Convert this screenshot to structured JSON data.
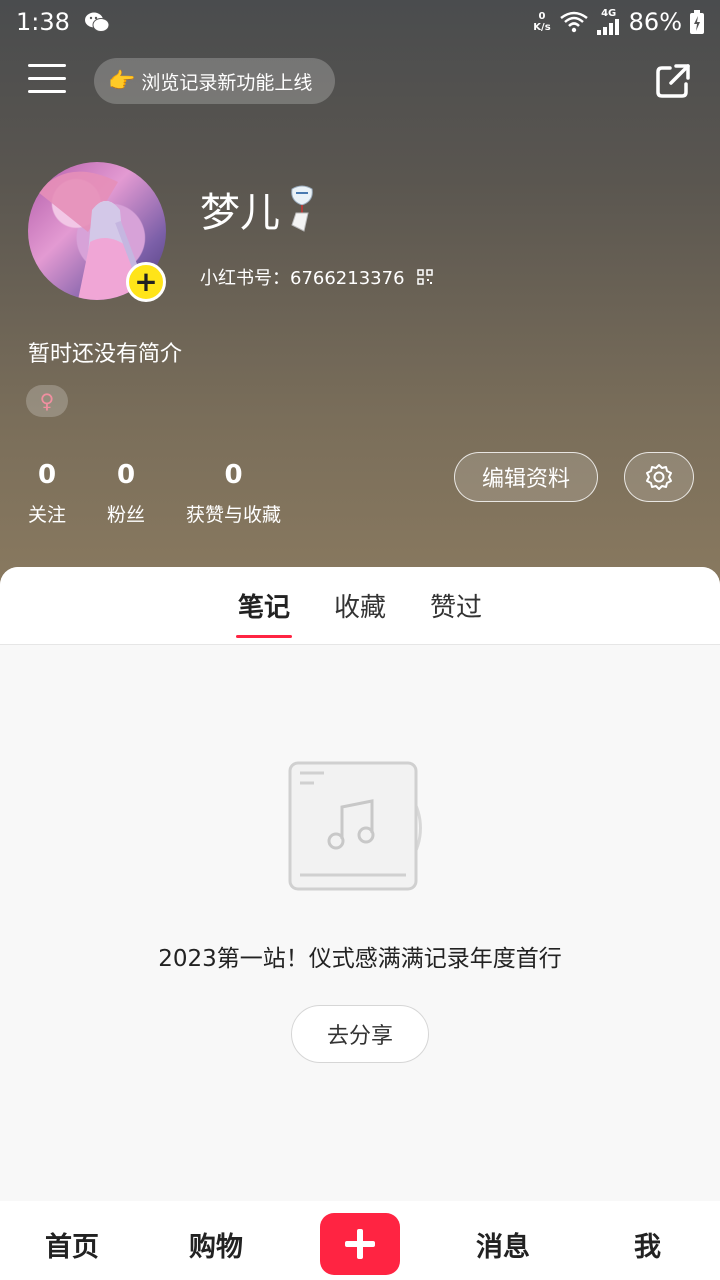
{
  "status_bar": {
    "time": "1:38",
    "net_speed_value": "0",
    "net_speed_unit": "K/s",
    "network": "4G",
    "battery": "86%"
  },
  "header": {
    "history_banner": "浏览记录新功能上线"
  },
  "profile": {
    "username": "梦儿",
    "red_id": "小红书号：6766213376",
    "bio": "暂时还没有简介",
    "gender_symbol": "♀"
  },
  "stats": [
    {
      "value": "0",
      "label": "关注"
    },
    {
      "value": "0",
      "label": "粉丝"
    },
    {
      "value": "0",
      "label": "获赞与收藏"
    }
  ],
  "actions": {
    "edit_profile": "编辑资料"
  },
  "tabs": [
    {
      "label": "笔记",
      "active": true
    },
    {
      "label": "收藏",
      "active": false
    },
    {
      "label": "赞过",
      "active": false
    }
  ],
  "empty_state": {
    "message": "2023第一站！仪式感满满记录年度首行",
    "button": "去分享"
  },
  "bottom_nav": {
    "home": "首页",
    "shop": "购物",
    "messages": "消息",
    "me": "我"
  },
  "colors": {
    "accent": "#ff2442",
    "avatar_add": "#ffe419"
  }
}
